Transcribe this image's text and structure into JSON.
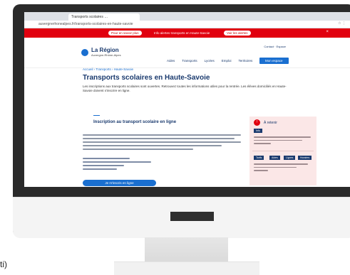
{
  "browser": {
    "tab_title": "Transports scolaires …",
    "address": "auvergnerhonealpes.fr/transports-scolaires-en-haute-savoie",
    "controls": "☆ ⋮"
  },
  "alert_bar": {
    "left_pill": "Pour en savoir plus",
    "text": "Info alertes transports en Haute-Savoie",
    "right_pill": "Voir les alertes",
    "close": "×"
  },
  "header": {
    "logo_name": "La Région",
    "logo_sub": "Auvergne-Rhône-Alpes",
    "utilities": "Contact  ·  Espace",
    "nav": [
      "Aides",
      "Transports",
      "Lycées",
      "Emploi",
      "Territoires"
    ],
    "nav_cta": "Mon espace"
  },
  "page": {
    "breadcrumb": "Accueil › Transports › Haute-Savoie",
    "title": "Transports scolaires en Haute-Savoie",
    "intro": "Les inscriptions aux transports scolaires sont ouvertes. Retrouvez toutes les informations utiles pour la rentrée. Les élèves domiciliés en Haute-Savoie doivent s'inscrire en ligne.",
    "section_title": "Inscription au transport scolaire en ligne",
    "cta": "Je m'inscris en ligne"
  },
  "aside": {
    "title": "À retenir",
    "badge_1": "Info",
    "badges_2": [
      "Tarifs",
      "Aides",
      "Lignes",
      "Horaires"
    ]
  },
  "device": {
    "caption": "ti)"
  }
}
